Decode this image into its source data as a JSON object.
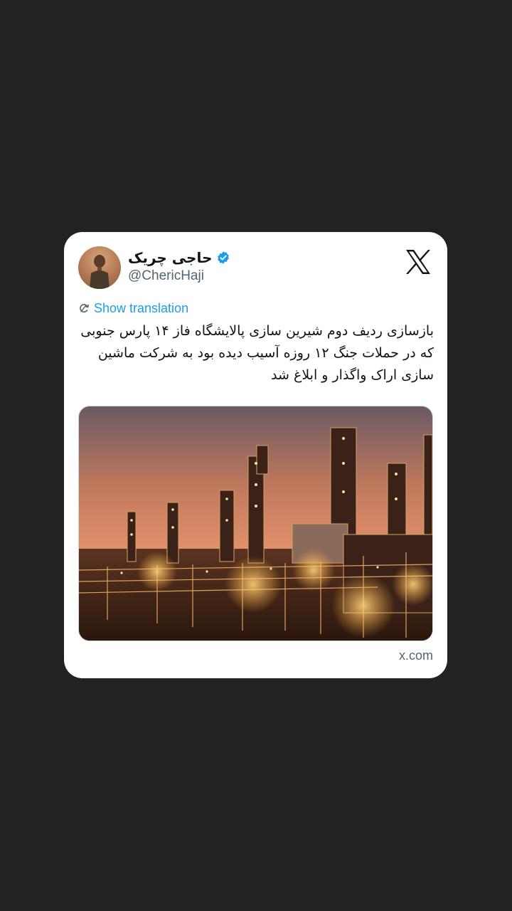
{
  "tweet": {
    "author_name": "حاجی چریک",
    "handle": "@ChericHaji",
    "verified": true,
    "show_translation_label": "Show translation",
    "text": "بازسازی ردیف دوم شیرین سازی پالایشگاه فاز ۱۴ پارس جنوبی که در حملات جنگ ۱۲ روزه آسیب دیده بود به شرکت ماشین سازی اراک واگذار و ابلاغ شد",
    "source_domain": "x.com"
  },
  "icons": {
    "platform_logo": "x-logo-icon",
    "verified_badge": "verified-badge-icon",
    "translate": "translate-icon"
  },
  "colors": {
    "background": "#222222",
    "card": "#ffffff",
    "link": "#1d9bf0",
    "verified": "#1d9bf0",
    "secondary_text": "#536471",
    "primary_text": "#0f1419"
  }
}
